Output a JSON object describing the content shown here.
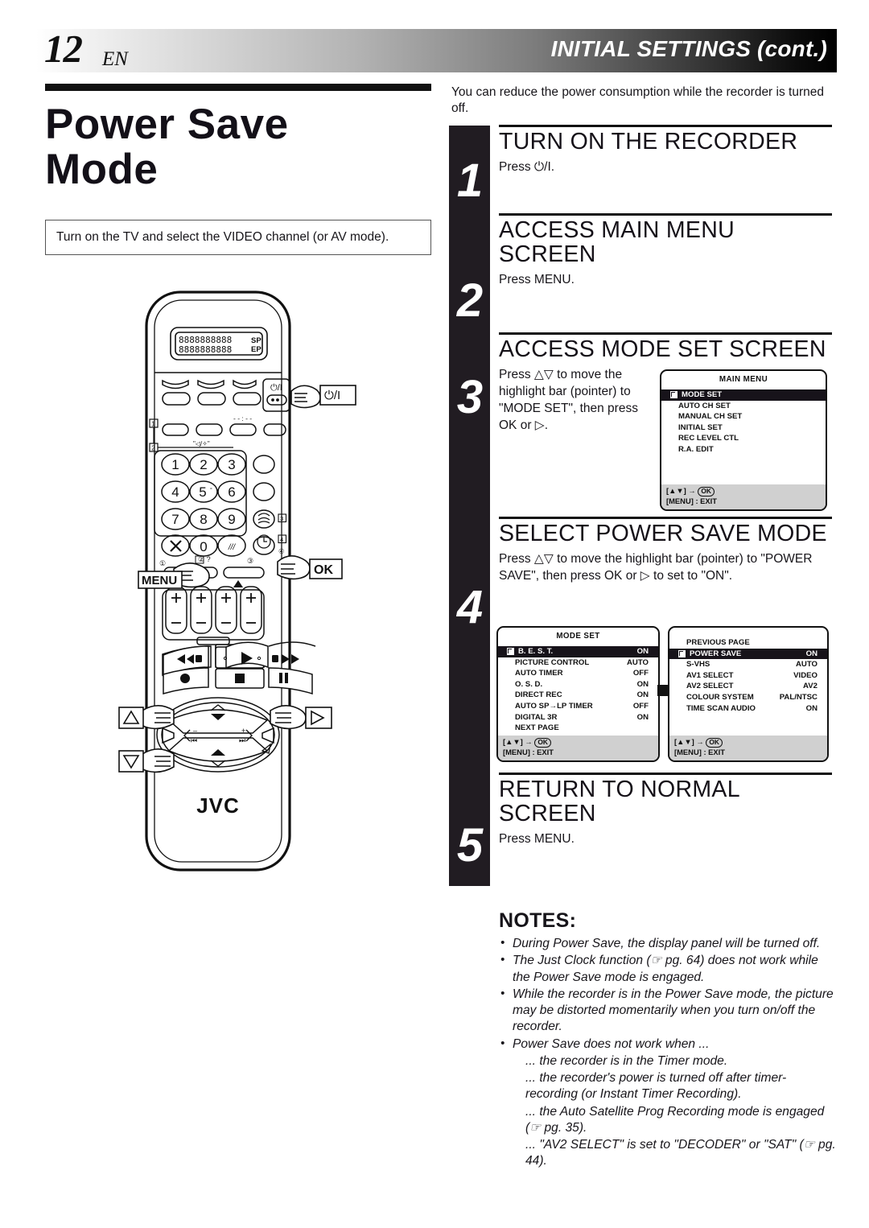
{
  "header": {
    "page_number": "12",
    "lang": "EN",
    "title": "INITIAL SETTINGS (cont.)"
  },
  "left": {
    "big_title_line1": "Power Save",
    "big_title_line2": "Mode",
    "tv_note": "Turn on the TV and select the VIDEO channel (or AV mode).",
    "remote": {
      "brand": "JVC",
      "display_sp": "SP",
      "display_ep": "EP",
      "keys": [
        "1",
        "2",
        "3",
        "4",
        "5°",
        "6",
        "7",
        "8",
        "9",
        "0"
      ],
      "callouts": [
        {
          "name": "power-callout",
          "label": "⏻/I"
        },
        {
          "name": "menu-callout",
          "label": "MENU"
        },
        {
          "name": "ok-callout",
          "label": "OK"
        },
        {
          "name": "up-callout",
          "label": "△"
        },
        {
          "name": "down-callout",
          "label": "▽"
        },
        {
          "name": "right-callout",
          "label": "▷"
        }
      ],
      "markers": [
        "1",
        "2",
        "3",
        "4"
      ],
      "circle_markers": [
        "①",
        "②",
        "③",
        "④"
      ]
    }
  },
  "intro": "You can reduce the power consumption while the recorder is turned off.",
  "steps": [
    {
      "number": "1",
      "title": "TURN ON THE RECORDER",
      "body": "Press ⏻/I."
    },
    {
      "number": "2",
      "title": "ACCESS MAIN MENU SCREEN",
      "body": "Press MENU."
    },
    {
      "number": "3",
      "title": "ACCESS MODE SET SCREEN",
      "body": "Press △▽ to move the highlight bar (pointer) to \"MODE SET\", then press OK or ▷."
    },
    {
      "number": "4",
      "title": "SELECT POWER SAVE MODE",
      "body": "Press △▽ to move the highlight bar (pointer) to \"POWER SAVE\", then press OK or ▷ to set to \"ON\"."
    },
    {
      "number": "5",
      "title": "RETURN TO NORMAL SCREEN",
      "body": "Press MENU."
    }
  ],
  "osd": {
    "main_menu": {
      "title": "MAIN MENU",
      "rows": [
        {
          "label": "MODE SET",
          "value": "",
          "highlight": true,
          "icon": true
        },
        {
          "label": "AUTO CH SET",
          "value": "",
          "highlight": false,
          "icon": false
        },
        {
          "label": "MANUAL CH SET",
          "value": "",
          "highlight": false,
          "icon": false
        },
        {
          "label": "INITIAL SET",
          "value": "",
          "highlight": false,
          "icon": false
        },
        {
          "label": "REC LEVEL CTL",
          "value": "",
          "highlight": false,
          "icon": false
        },
        {
          "label": "R.A. EDIT",
          "value": "",
          "highlight": false,
          "icon": false
        }
      ],
      "foot_line1_pre": "[▲▼]",
      "foot_line1_arrow": "→",
      "foot_line1_ok": "OK",
      "foot_line2": "[MENU] : EXIT"
    },
    "mode_set": {
      "title": "MODE SET",
      "rows": [
        {
          "label": "B. E. S. T.",
          "value": "ON",
          "highlight": true,
          "icon": true
        },
        {
          "label": "PICTURE CONTROL",
          "value": "AUTO",
          "highlight": false,
          "icon": false
        },
        {
          "label": "AUTO TIMER",
          "value": "OFF",
          "highlight": false,
          "icon": false
        },
        {
          "label": "O. S. D.",
          "value": "ON",
          "highlight": false,
          "icon": false
        },
        {
          "label": "DIRECT REC",
          "value": "ON",
          "highlight": false,
          "icon": false
        },
        {
          "label": "AUTO SP→LP TIMER",
          "value": "OFF",
          "highlight": false,
          "icon": false
        },
        {
          "label": "DIGITAL 3R",
          "value": "ON",
          "highlight": false,
          "icon": false
        },
        {
          "label": "NEXT PAGE",
          "value": "",
          "highlight": false,
          "icon": false
        }
      ],
      "foot_line1_pre": "[▲▼]",
      "foot_line1_arrow": "→",
      "foot_line1_ok": "OK",
      "foot_line2": "[MENU] : EXIT"
    },
    "mode_set_page2": {
      "title": "",
      "rows": [
        {
          "label": "PREVIOUS PAGE",
          "value": "",
          "highlight": false,
          "icon": false
        },
        {
          "label": "POWER SAVE",
          "value": "ON",
          "highlight": true,
          "icon": true
        },
        {
          "label": "S-VHS",
          "value": "AUTO",
          "highlight": false,
          "icon": false
        },
        {
          "label": "AV1 SELECT",
          "value": "VIDEO",
          "highlight": false,
          "icon": false
        },
        {
          "label": "AV2 SELECT",
          "value": "AV2",
          "highlight": false,
          "icon": false
        },
        {
          "label": "COLOUR SYSTEM",
          "value": "PAL/NTSC",
          "highlight": false,
          "icon": false
        },
        {
          "label": "TIME SCAN AUDIO",
          "value": "ON",
          "highlight": false,
          "icon": false
        }
      ],
      "foot_line1_pre": "[▲▼]",
      "foot_line1_arrow": "→",
      "foot_line1_ok": "OK",
      "foot_line2": "[MENU] : EXIT"
    }
  },
  "notes": {
    "heading": "NOTES:",
    "items": [
      {
        "text": "During Power Save, the display panel will be turned off.",
        "sub": false
      },
      {
        "text": "The Just Clock function (☞ pg. 64) does not work while the Power Save mode is engaged.",
        "sub": false
      },
      {
        "text": "While the recorder is in the Power Save mode, the picture may be distorted momentarily when you turn on/off the recorder.",
        "sub": false
      },
      {
        "text": "Power Save does not work when ...",
        "sub": false
      },
      {
        "text": "... the recorder is in the Timer mode.",
        "sub": true
      },
      {
        "text": "... the recorder's power is turned off after timer-recording (or Instant Timer Recording).",
        "sub": true
      },
      {
        "text": "... the Auto Satellite Prog Recording mode is engaged (☞ pg. 35).",
        "sub": true
      },
      {
        "text": "... \"AV2 SELECT\" is set to \"DECODER\" or \"SAT\" (☞ pg. 44).",
        "sub": true
      }
    ]
  },
  "colors": {
    "ink": "#17151a",
    "bar": "#211c22",
    "osd_foot": "#d0d0d0"
  }
}
